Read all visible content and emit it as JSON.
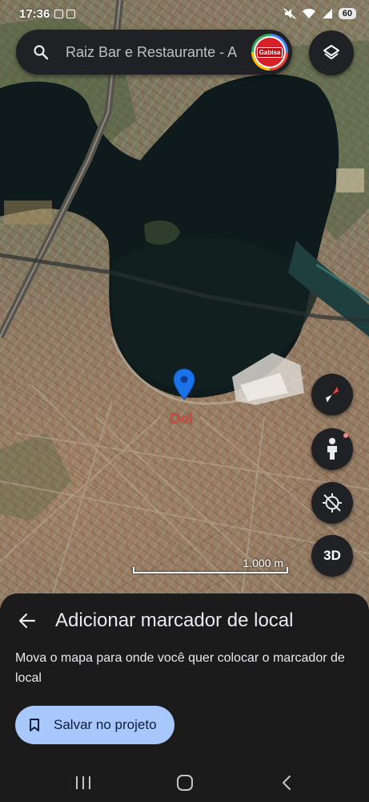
{
  "status_bar": {
    "time": "17:36",
    "battery": "60"
  },
  "search": {
    "text": "Raiz Bar e Restaurante - A",
    "avatar_text": "Gabisa"
  },
  "map": {
    "scale_label": "1.000 m",
    "place_label": "Dol",
    "three_d_label": "3D"
  },
  "bottom_sheet": {
    "title": "Adicionar marcador de local",
    "description": "Mova o mapa para onde você quer colocar o marcador de local",
    "save_button_label": "Salvar no projeto"
  },
  "icons": {
    "search": "search-icon",
    "layers": "layers-icon",
    "compass": "compass-icon",
    "pegman": "pegman-icon",
    "location": "location-off-icon",
    "back": "back-arrow-icon",
    "bookmark": "bookmark-icon",
    "recents": "recents-icon",
    "home": "home-icon",
    "nav_back": "nav-back-icon"
  },
  "colors": {
    "accent": "#a8c7fa",
    "marker": "#1a73e8",
    "sheet_bg": "#1b1b1b"
  }
}
